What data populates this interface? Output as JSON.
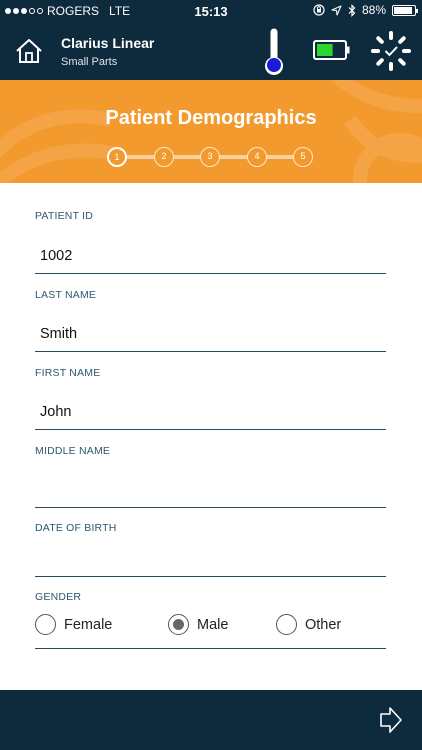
{
  "status_bar": {
    "carrier": "ROGERS",
    "network": "LTE",
    "time": "15:13",
    "battery_percent": "88%",
    "battery_level": 0.88
  },
  "header": {
    "title": "Clarius Linear",
    "subtitle": "Small Parts",
    "probe_battery_level": 0.6,
    "colors": {
      "background": "#0e2a3d",
      "battery_fill": "#2fd52f",
      "thermo_fill": "#1b1bd6"
    }
  },
  "banner": {
    "title": "Patient Demographics",
    "color": "#f39a2f",
    "steps": [
      "1",
      "2",
      "3",
      "4",
      "5"
    ],
    "current_step": 1
  },
  "form": {
    "patient_id": {
      "label": "PATIENT ID",
      "value": "1002"
    },
    "last_name": {
      "label": "LAST NAME",
      "value": "Smith"
    },
    "first_name": {
      "label": "FIRST NAME",
      "value": "John"
    },
    "middle_name": {
      "label": "MIDDLE NAME",
      "value": ""
    },
    "date_of_birth": {
      "label": "DATE OF BIRTH",
      "value": ""
    },
    "gender": {
      "label": "GENDER",
      "options": [
        "Female",
        "Male",
        "Other"
      ],
      "selected": "Male"
    }
  }
}
